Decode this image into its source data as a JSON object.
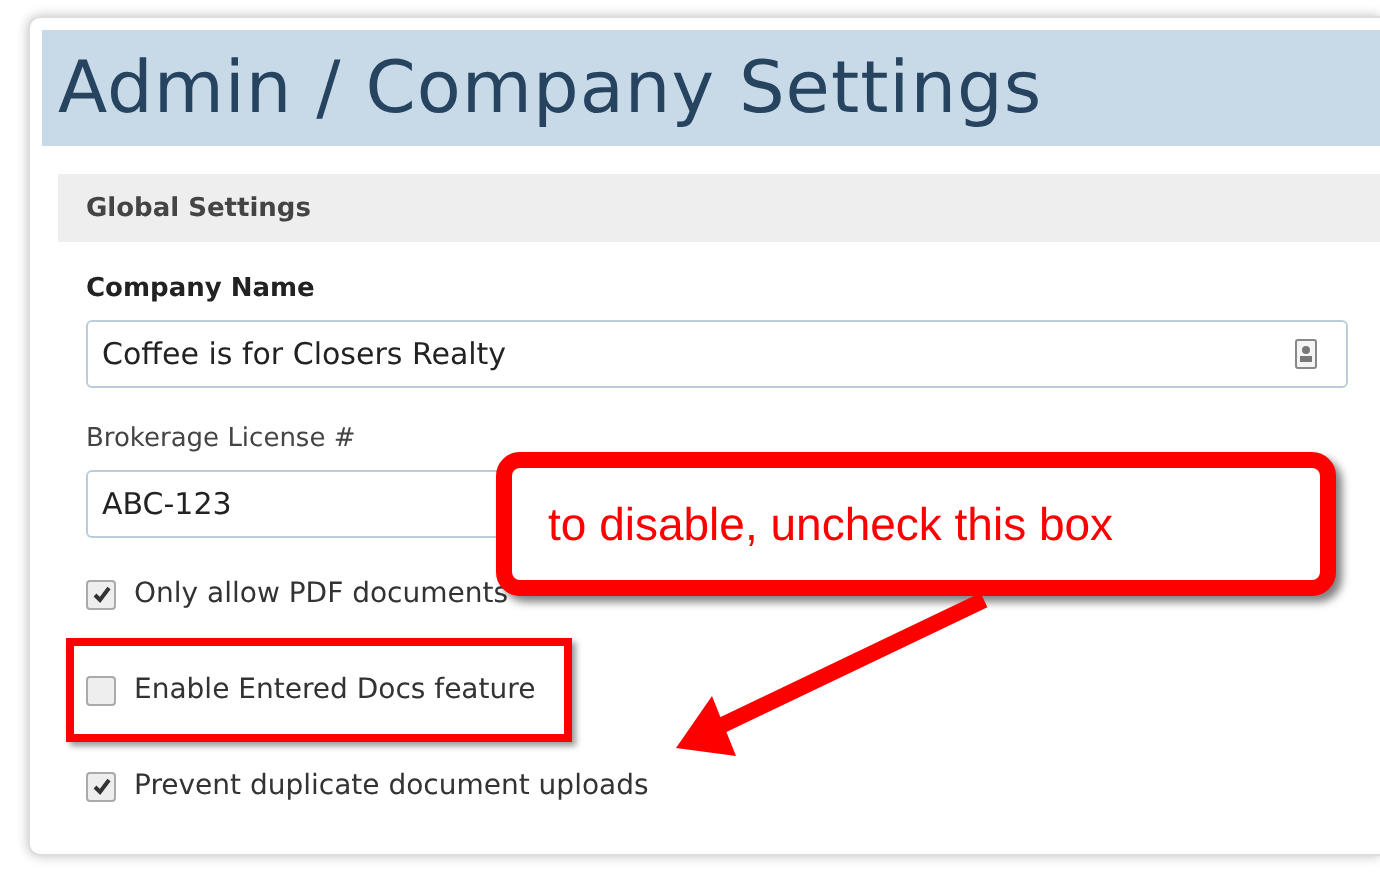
{
  "page": {
    "title": "Admin / Company Settings"
  },
  "section": {
    "title": "Global Settings"
  },
  "fields": [
    {
      "label": "Company Name",
      "value": "Coffee is for Closers Realty",
      "kind": "contact"
    },
    {
      "label": "Brokerage License #",
      "value": "ABC-123",
      "kind": "plain"
    }
  ],
  "options": [
    {
      "label": "Only allow PDF documents",
      "checked": true,
      "highlighted": false
    },
    {
      "label": "Enable Entered Docs feature",
      "checked": false,
      "highlighted": true
    },
    {
      "label": "Prevent duplicate document uploads",
      "checked": true,
      "highlighted": false
    }
  ],
  "annotation": {
    "text": "to disable, uncheck this box"
  }
}
